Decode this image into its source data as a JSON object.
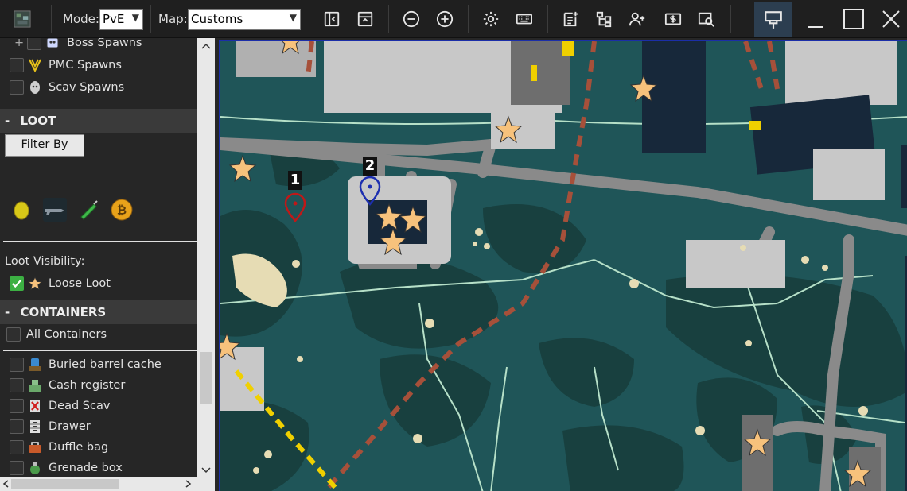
{
  "toolbar": {
    "mode_label": "Mode:",
    "mode_value": "PvE",
    "map_label": "Map:",
    "map_value": "Customs"
  },
  "sidebar": {
    "spawns": [
      {
        "label": "Boss Spawns",
        "checked": false,
        "icon": "boss-icon"
      },
      {
        "label": "PMC Spawns",
        "checked": false,
        "icon": "pmc-icon"
      },
      {
        "label": "Scav Spawns",
        "checked": false,
        "icon": "scav-icon"
      }
    ],
    "loot_section": {
      "collapse": "-",
      "title": "LOOT"
    },
    "filter_button": "Filter By",
    "loot_visibility_label": "Loot Visibility:",
    "loose_loot": {
      "label": "Loose Loot",
      "checked": true
    },
    "containers_section": {
      "collapse": "-",
      "title": "CONTAINERS"
    },
    "all_containers": {
      "label": "All Containers",
      "checked": false
    },
    "containers": [
      {
        "label": "Buried barrel cache",
        "checked": false
      },
      {
        "label": "Cash register",
        "checked": false
      },
      {
        "label": "Dead Scav",
        "checked": false
      },
      {
        "label": "Drawer",
        "checked": false
      },
      {
        "label": "Duffle bag",
        "checked": false
      },
      {
        "label": "Grenade box",
        "checked": false
      }
    ],
    "tree_expand": "+"
  },
  "map": {
    "marker_1_label": "1",
    "marker_2_label": "2"
  },
  "colors": {
    "map_bg": "#1f5558",
    "forest": "#18403f",
    "road": "#8a8a8a",
    "building": "#c8c8c8",
    "star": "#f7c27c",
    "marker_1": "#c01818",
    "marker_2": "#1d2fb0"
  }
}
